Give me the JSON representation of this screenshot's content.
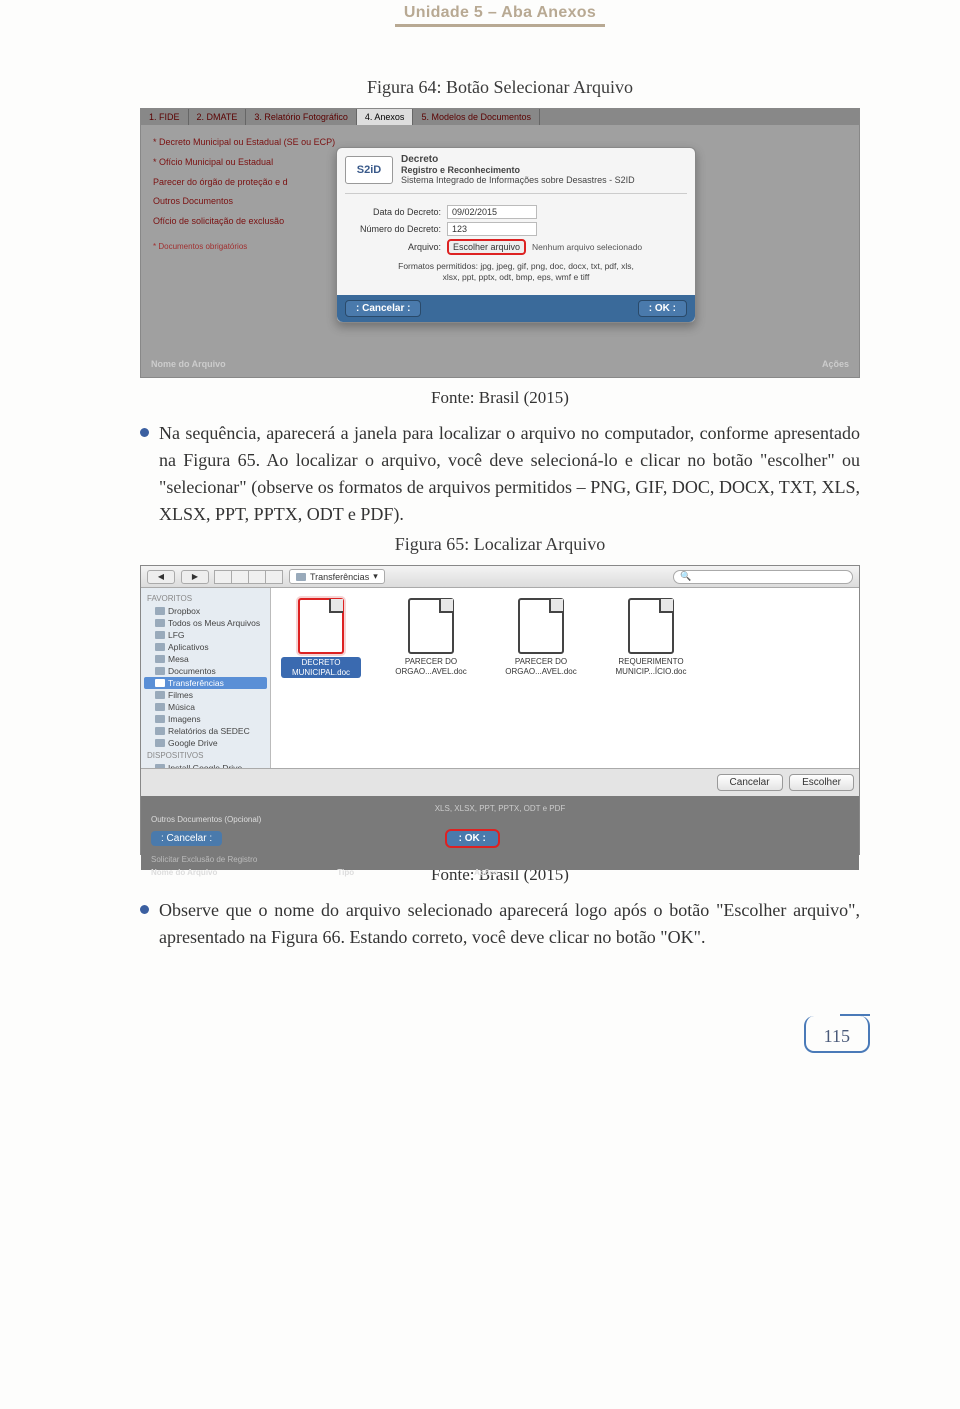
{
  "header": {
    "title": "Unidade 5 – Aba Anexos"
  },
  "fig1": {
    "caption": "Figura 64: Botão Selecionar Arquivo",
    "tabs": [
      "1. FIDE",
      "2. DMATE",
      "3. Relatório Fotográfico",
      "4. Anexos",
      "5. Modelos de Documentos"
    ],
    "active_tab": 3,
    "bg_items": [
      "* Decreto Municipal ou Estadual (SE ou ECP)",
      "* Ofício Municipal ou Estadual",
      "Parecer do órgão de proteção e d",
      "Outros Documentos",
      "Ofício de solicitação de exclusão"
    ],
    "bg_note": "* Documentos obrigatórios",
    "dialog": {
      "logo": "S2iD",
      "title1": "Decreto",
      "title2": "Registro e Reconhecimento",
      "subtitle": "Sistema Integrado de Informações sobre Desastres - S2ID",
      "fld_date_label": "Data do Decreto:",
      "fld_date_value": "09/02/2015",
      "fld_num_label": "Número do Decreto:",
      "fld_num_value": "123",
      "fld_file_label": "Arquivo:",
      "file_button": "Escolher arquivo",
      "file_status": "Nenhum arquivo selecionado",
      "formats_line1": "Formatos permitidos: jpg, jpeg, gif, png, doc, docx, txt, pdf, xls,",
      "formats_line2": "xlsx, ppt, pptx, odt, bmp, eps, wmf e tiff",
      "btn_cancel": ": Cancelar :",
      "btn_ok": ": OK :"
    },
    "footer_left": "Nome do Arquivo",
    "footer_right": "Ações"
  },
  "source1": "Fonte: Brasil (2015)",
  "para1": "Na sequência, aparecerá a janela para localizar o arquivo no computador, conforme apresentado na Figura 65. Ao localizar o arquivo, você deve selecioná-lo e clicar no botão \"escolher\" ou \"selecionar\" (observe os formatos de arquivos permitidos – PNG, GIF, DOC, DOCX, TXT, XLS, XLSX, PPT, PPTX, ODT e PDF).",
  "fig2": {
    "caption": "Figura 65: Localizar Arquivo",
    "location": "Transferências",
    "search_placeholder": "Q",
    "sb_hdr1": "FAVORITOS",
    "sb_items1": [
      "Dropbox",
      "Todos os Meus Arquivos",
      "LFG",
      "Aplicativos",
      "Mesa",
      "Documentos",
      "Transferências",
      "Filmes",
      "Música",
      "Imagens",
      "Relatórios da SEDEC",
      "Google Drive"
    ],
    "sb_selected": "Transferências",
    "sb_hdr2": "DISPOSITIVOS",
    "sb_items2": [
      "Install Google Drive"
    ],
    "files": [
      {
        "label": "DECRETO MUNICIPAL.doc",
        "selected": true
      },
      {
        "label": "PARECER DO ORGAO...AVEL.doc",
        "selected": false
      },
      {
        "label": "PARECER DO ORGAO...AVEL.doc",
        "selected": false
      },
      {
        "label": "REQUERIMENTO MUNICIP...ÍCIO.doc",
        "selected": false
      }
    ],
    "btn_cancel": "Cancelar",
    "btn_choose": "Escolher",
    "under_formats": "XLS, XLSX, PPT, PPTX, ODT e PDF",
    "under_outros": "Outros Documentos (Opcional)",
    "under_cancel": ": Cancelar :",
    "under_ok": ": OK :",
    "under_nome": "Nome do Arquivo",
    "under_tipo": "Tipo",
    "under_acoes": "Ações",
    "under_solicitar": "Solicitar Exclusão de Registro"
  },
  "source2": "Fonte: Brasil (2015)",
  "para2": "Observe que o nome do arquivo selecionado aparecerá logo após o botão \"Escolher arquivo\", apresentado na Figura 66. Estando correto, você deve clicar no botão \"OK\".",
  "page_number": "115"
}
